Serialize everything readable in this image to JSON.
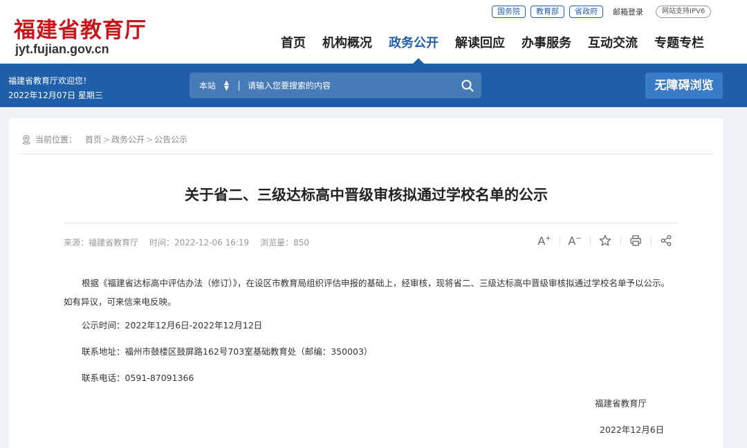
{
  "header": {
    "logo_cn": "福建省教育厅",
    "logo_en": "jyt.fujian.gov.cn",
    "top_links": [
      "国务院",
      "教育部",
      "省政府"
    ],
    "mail_login": "邮箱登录",
    "ipv6": "网站支持IPV6",
    "nav": [
      "首页",
      "机构概况",
      "政务公开",
      "解读回应",
      "办事服务",
      "互动交流",
      "专题专栏"
    ],
    "nav_active": "政务公开"
  },
  "bluebar": {
    "welcome": "福建省教育厅欢迎您！",
    "date": "2022年12月07日 星期三",
    "search_scope": "本站",
    "search_placeholder": "请输入您要搜索的内容",
    "accessibility": "无障碍浏览"
  },
  "breadcrumb": {
    "label": "当前位置：",
    "items": [
      "首页",
      "政务公开",
      "公告公示"
    ]
  },
  "article": {
    "title": "关于省二、三级达标高中晋级审核拟通过学校名单的公示",
    "source": "来源：福建省教育厅",
    "time": "时间：2022-12-06 16:19",
    "views": "浏览量：850",
    "paragraphs": [
      "根据《福建省达标高中评估办法（修订）》，在设区市教育局组织评估申报的基础上，经审核，现将省二、三级达标高中晋级审核拟通过学校名单予以公示。如有异议，可来信来电反映。",
      "公示时间：2022年12月6日-2022年12月12日",
      "联系地址：福州市鼓楼区鼓屏路162号703室基础教育处（邮编：350003）",
      "联系电话：0591-87091366"
    ],
    "signature": "福建省教育厅",
    "sign_date": "2022年12月6日"
  },
  "icons": {
    "font_increase": "font-increase-icon",
    "font_decrease": "font-decrease-icon",
    "favorite": "star-icon",
    "print": "print-icon",
    "share": "share-icon"
  },
  "colors": {
    "brand_red": "#c8161d",
    "brand_blue": "#1f5ea8",
    "accessibility_button": "#3a7bc8",
    "page_background": "#eef1f5"
  }
}
